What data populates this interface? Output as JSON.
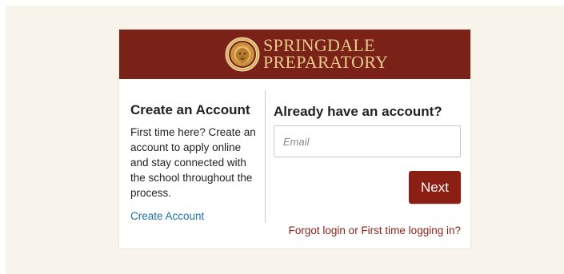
{
  "brand": {
    "line1": "SPRINGDALE",
    "line2": "PREPARATORY",
    "banner_color": "#7a2118",
    "text_color": "#e7c98b",
    "logo_icon": "lion-seal-icon"
  },
  "create_account": {
    "title": "Create an Account",
    "description": "First time here? Create an account to apply online and stay connected with the school throughout the process.",
    "link_label": "Create Account",
    "link_color": "#1b6fb1"
  },
  "login": {
    "title": "Already have an account?",
    "email_placeholder": "Email",
    "email_value": "",
    "next_label": "Next",
    "forgot_label": "Forgot login or First time logging in?",
    "accent_color": "#8c1f14"
  }
}
